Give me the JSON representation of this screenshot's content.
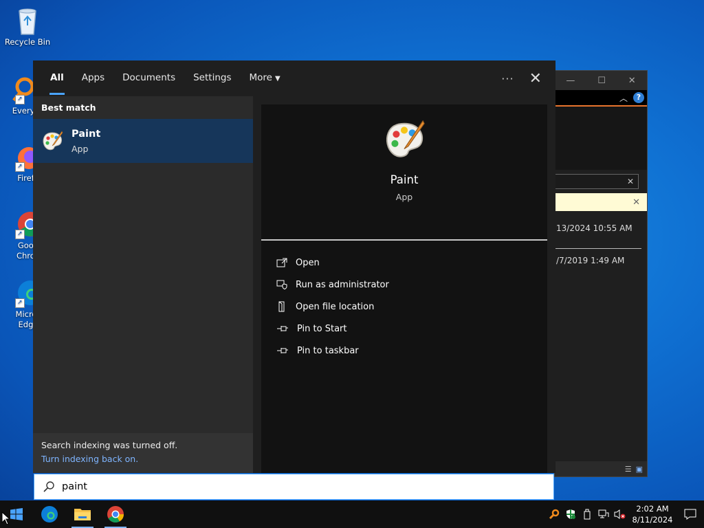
{
  "desktop": {
    "icons": [
      {
        "label": "Recycle Bin"
      },
      {
        "label": "Everyth"
      },
      {
        "label": "Firefo"
      },
      {
        "label": "Goog\nChron"
      },
      {
        "label": "Micros\nEdge"
      }
    ]
  },
  "background_window": {
    "date_1": "13/2024 10:55 AM",
    "date_2": "/7/2019 1:49 AM"
  },
  "start_search": {
    "tabs": [
      {
        "label": "All",
        "active": true
      },
      {
        "label": "Apps"
      },
      {
        "label": "Documents"
      },
      {
        "label": "Settings"
      },
      {
        "label": "More"
      }
    ],
    "best_match_label": "Best match",
    "result": {
      "name": "Paint",
      "type": "App"
    },
    "index_notice": {
      "text": "Search indexing was turned off.",
      "link": "Turn indexing back on."
    },
    "preview": {
      "name": "Paint",
      "type": "App"
    },
    "actions": [
      {
        "label": "Open",
        "icon": "open-icon"
      },
      {
        "label": "Run as administrator",
        "icon": "shield-icon"
      },
      {
        "label": "Open file location",
        "icon": "file-location-icon"
      },
      {
        "label": "Pin to Start",
        "icon": "pin-icon"
      },
      {
        "label": "Pin to taskbar",
        "icon": "pin-icon"
      }
    ]
  },
  "search_box": {
    "value": "paint"
  },
  "taskbar": {
    "clock_time": "2:02 AM",
    "clock_date": "8/11/2024"
  },
  "colors": {
    "accent": "#4aa3ff",
    "selected_result": "#16365a",
    "panel_bg": "#1f1f1f"
  }
}
